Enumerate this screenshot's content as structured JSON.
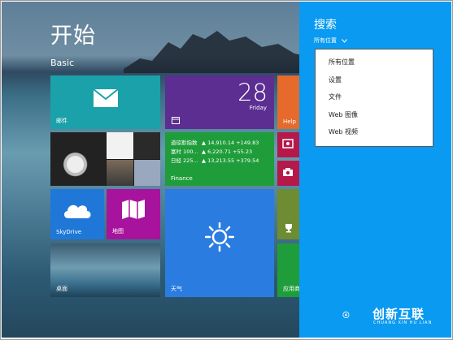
{
  "start": {
    "title": "开始",
    "user": "Basic"
  },
  "tiles": {
    "mail": {
      "label": "邮件"
    },
    "calendar": {
      "day": "28",
      "weekday": "Friday"
    },
    "help": {
      "label": "Help"
    },
    "finance": {
      "label": "Finance",
      "rows": [
        {
          "name": "道琼斯指数",
          "value": "▲ 14,910.14 +149.83"
        },
        {
          "name": "富时 100...",
          "value": "▲ 6,220.71 +55.23"
        },
        {
          "name": "日经 225...",
          "value": "▲ 13,213.55 +379.54"
        }
      ]
    },
    "skydrive": {
      "label": "SkyDrive"
    },
    "maps": {
      "label": "地图"
    },
    "weather": {
      "label": "天气"
    },
    "desktop": {
      "label": "桌面"
    },
    "store": {
      "label": "应用商"
    }
  },
  "search": {
    "title": "搜索",
    "scope": "所有位置",
    "options": [
      "所有位置",
      "设置",
      "文件",
      "Web 图像",
      "Web 视频"
    ]
  },
  "watermark": {
    "name": "创新互联",
    "sub": "CHUANG XIN HU LIAN"
  },
  "colors": {
    "charm": "#0a9af1",
    "mail": "#1ba1a9",
    "calendar": "#5c2e91",
    "finance": "#1f9d3a",
    "skydrive": "#1f78d8",
    "maps": "#a8139d",
    "weather": "#2b7ce0"
  }
}
